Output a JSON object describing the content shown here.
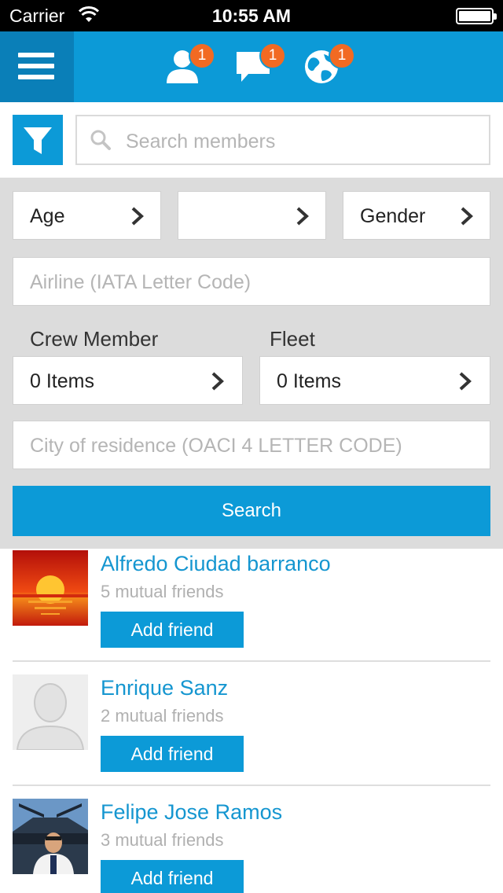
{
  "status_bar": {
    "carrier": "Carrier",
    "time": "10:55 AM"
  },
  "nav": {
    "icons": [
      {
        "name": "person-icon",
        "badge": "1"
      },
      {
        "name": "chat-icon",
        "badge": "1"
      },
      {
        "name": "globe-icon",
        "badge": "1"
      }
    ]
  },
  "search": {
    "placeholder": "Search members"
  },
  "filters": {
    "age_label": "Age",
    "middle_label": "",
    "gender_label": "Gender",
    "airline_placeholder": "Airline (IATA Letter Code)",
    "crew_member_label": "Crew Member",
    "crew_member_value": "0 Items",
    "fleet_label": "Fleet",
    "fleet_value": "0 Items",
    "city_placeholder": "City of residence (OACI 4 LETTER CODE)",
    "search_button": "Search"
  },
  "friends": [
    {
      "name": "Alfredo Ciudad barranco",
      "mutual": "5 mutual friends",
      "action": "Add friend",
      "avatar": "sunset-photo"
    },
    {
      "name": "Enrique Sanz",
      "mutual": "2 mutual friends",
      "action": "Add friend",
      "avatar": "default-silhouette"
    },
    {
      "name": "Felipe Jose Ramos",
      "mutual": "3 mutual friends",
      "action": "Add friend",
      "avatar": "pilot-cockpit-photo"
    }
  ],
  "colors": {
    "primary": "#0c9ad7",
    "primary_dark": "#0a7fb8",
    "badge": "#f26a22",
    "panel": "#dcdcdc",
    "link": "#1596d0"
  }
}
